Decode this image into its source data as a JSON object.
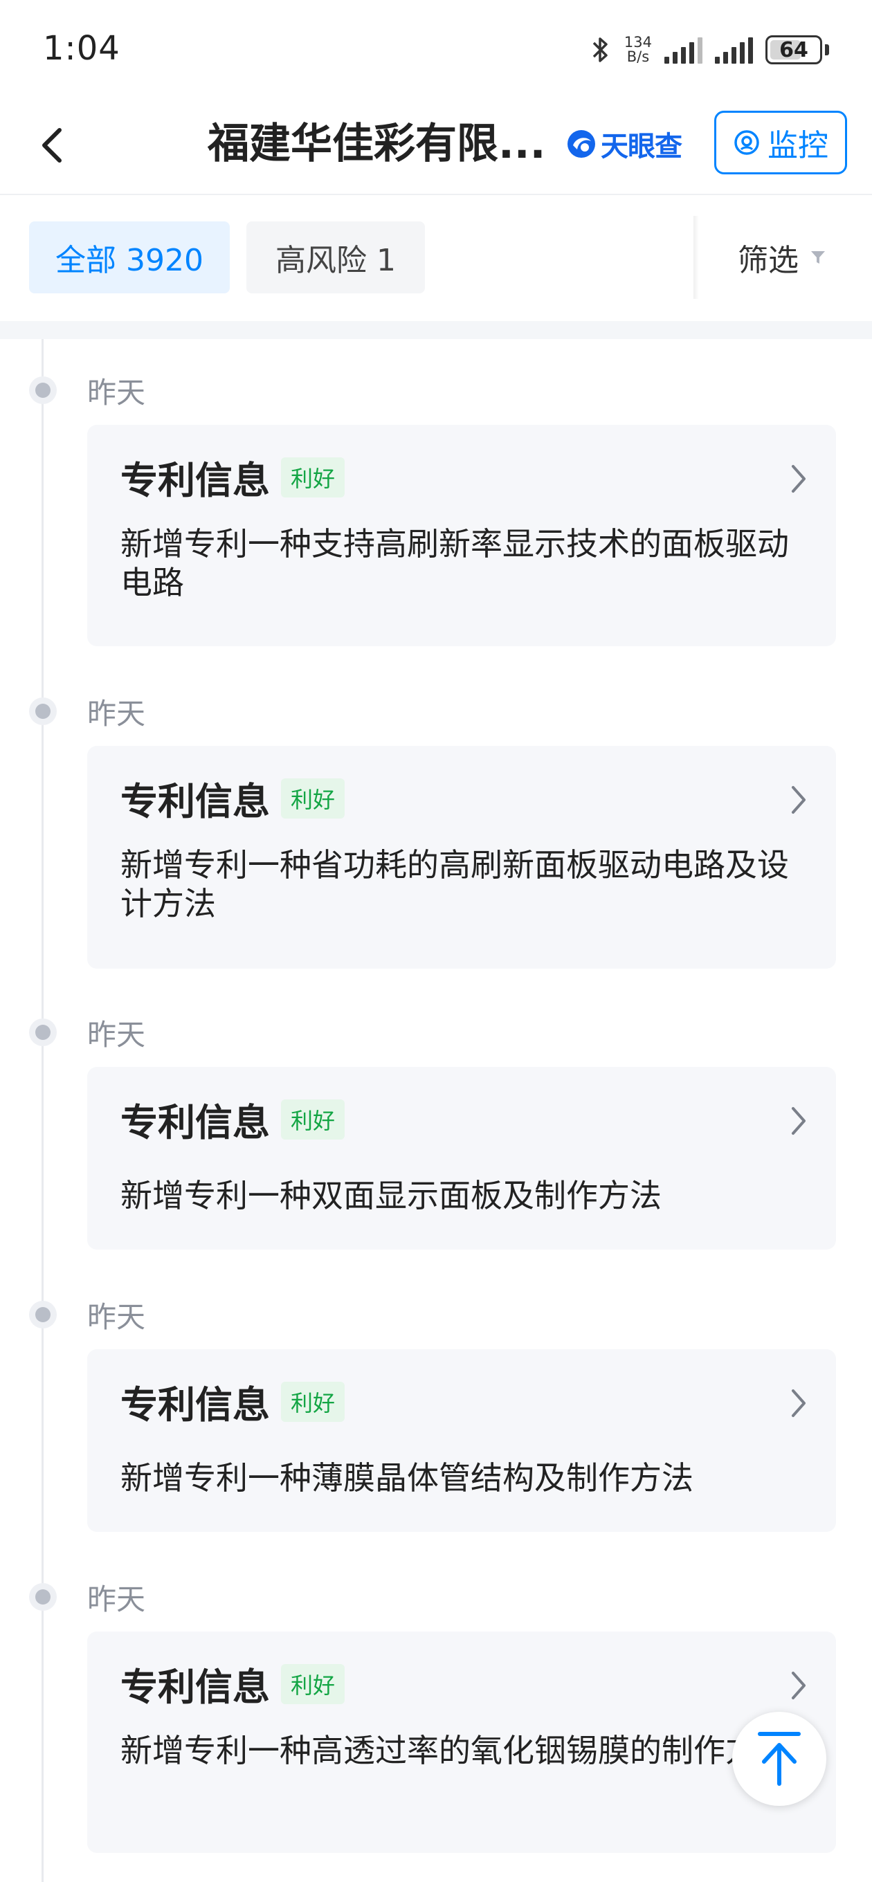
{
  "status_bar": {
    "time": "1:04",
    "net_speed_value": "134",
    "net_speed_unit": "B/s",
    "battery": "64"
  },
  "header": {
    "title": "福建华佳彩有限...",
    "brand": "天眼查",
    "monitor_label": "监控"
  },
  "filters": {
    "tab_all": "全部 3920",
    "tab_high_risk": "高风险 1",
    "filter_label": "筛选"
  },
  "entries": [
    {
      "date": "昨天",
      "title": "专利信息",
      "badge": "利好",
      "body": "新增专利一种支持高刷新率显示技术的面板驱动电路"
    },
    {
      "date": "昨天",
      "title": "专利信息",
      "badge": "利好",
      "body": "新增专利一种省功耗的高刷新面板驱动电路及设计方法"
    },
    {
      "date": "昨天",
      "title": "专利信息",
      "badge": "利好",
      "body": "新增专利一种双面显示面板及制作方法"
    },
    {
      "date": "昨天",
      "title": "专利信息",
      "badge": "利好",
      "body": "新增专利一种薄膜晶体管结构及制作方法"
    },
    {
      "date": "昨天",
      "title": "专利信息",
      "badge": "利好",
      "body": "新增专利一种高透过率的氧化铟锡膜的制作方法"
    }
  ],
  "colors": {
    "accent": "#0084ff",
    "brand": "#1366ec",
    "good_badge": "#13a544"
  }
}
